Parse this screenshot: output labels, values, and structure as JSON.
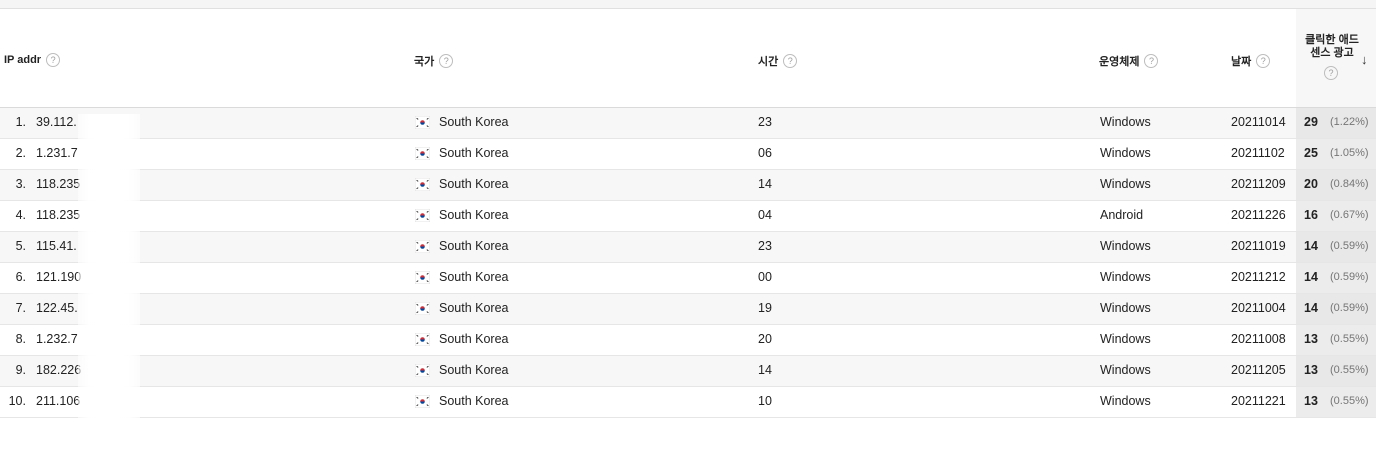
{
  "columns": {
    "ip": "IP addr",
    "country": "국가",
    "time": "시간",
    "os": "운영체제",
    "date": "날짜",
    "clicks_line1": "클릭한 애드",
    "clicks_line2": "센스 광고",
    "help_glyph": "?",
    "sort_glyph": "↓"
  },
  "rows": [
    {
      "idx": "1.",
      "ip": "39.112.",
      "flag": "kr-flag-icon",
      "country": "South Korea",
      "time": "23",
      "os": "Windows",
      "date": "20211014",
      "clicks": "29",
      "pct": "(1.22%)"
    },
    {
      "idx": "2.",
      "ip": "1.231.7",
      "flag": "kr-flag-icon",
      "country": "South Korea",
      "time": "06",
      "os": "Windows",
      "date": "20211102",
      "clicks": "25",
      "pct": "(1.05%)"
    },
    {
      "idx": "3.",
      "ip": "118.235",
      "flag": "kr-flag-icon",
      "country": "South Korea",
      "time": "14",
      "os": "Windows",
      "date": "20211209",
      "clicks": "20",
      "pct": "(0.84%)"
    },
    {
      "idx": "4.",
      "ip": "118.235",
      "flag": "kr-flag-icon",
      "country": "South Korea",
      "time": "04",
      "os": "Android",
      "date": "20211226",
      "clicks": "16",
      "pct": "(0.67%)"
    },
    {
      "idx": "5.",
      "ip": "115.41.",
      "flag": "kr-flag-icon",
      "country": "South Korea",
      "time": "23",
      "os": "Windows",
      "date": "20211019",
      "clicks": "14",
      "pct": "(0.59%)"
    },
    {
      "idx": "6.",
      "ip": "121.190",
      "flag": "kr-flag-icon",
      "country": "South Korea",
      "time": "00",
      "os": "Windows",
      "date": "20211212",
      "clicks": "14",
      "pct": "(0.59%)"
    },
    {
      "idx": "7.",
      "ip": "122.45.",
      "flag": "kr-flag-icon",
      "country": "South Korea",
      "time": "19",
      "os": "Windows",
      "date": "20211004",
      "clicks": "14",
      "pct": "(0.59%)"
    },
    {
      "idx": "8.",
      "ip": "1.232.7",
      "flag": "kr-flag-icon",
      "country": "South Korea",
      "time": "20",
      "os": "Windows",
      "date": "20211008",
      "clicks": "13",
      "pct": "(0.55%)"
    },
    {
      "idx": "9.",
      "ip": "182.226",
      "flag": "kr-flag-icon",
      "country": "South Korea",
      "time": "14",
      "os": "Windows",
      "date": "20211205",
      "clicks": "13",
      "pct": "(0.55%)"
    },
    {
      "idx": "10.",
      "ip": "211.106",
      "flag": "kr-flag-icon",
      "country": "South Korea",
      "time": "10",
      "os": "Windows",
      "date": "20211221",
      "clicks": "13",
      "pct": "(0.55%)"
    }
  ]
}
